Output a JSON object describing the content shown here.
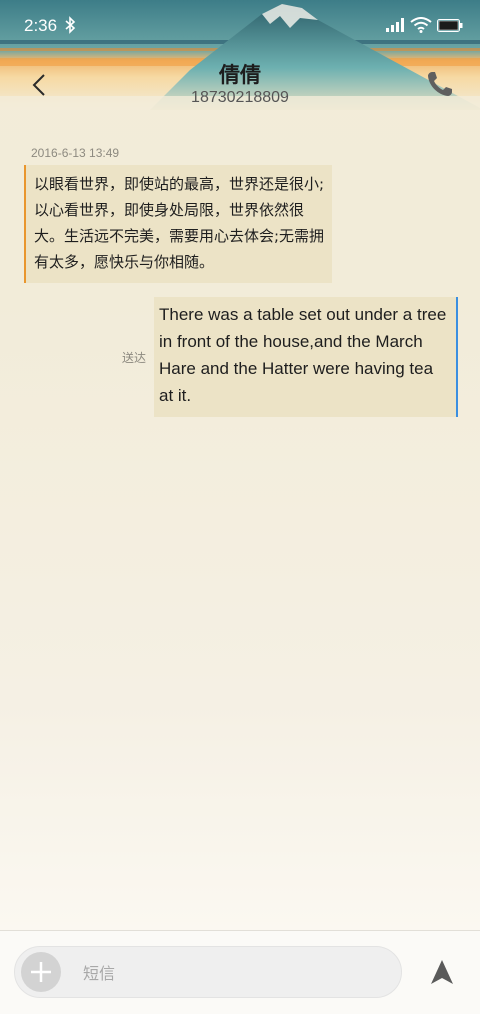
{
  "status_bar": {
    "time": "2:36"
  },
  "header": {
    "contact_name": "倩倩",
    "contact_number": "18730218809"
  },
  "conversation": {
    "timestamp": "2016-6-13 13:49",
    "messages": [
      {
        "direction": "incoming",
        "text": "以眼看世界，即使站的最高，世界还是很小;以心看世界，即使身处局限，世界依然很大。生活远不完美，需要用心去体会;无需拥有太多，愿快乐与你相随。"
      },
      {
        "direction": "outgoing",
        "text": "There was a table set out under a tree in front of the house,and the March Hare and the Hatter were having tea at it.",
        "status": "送达"
      }
    ]
  },
  "composer": {
    "placeholder": "短信"
  },
  "icons": {
    "back": "chevron-left-icon",
    "call": "phone-icon",
    "add": "plus-icon",
    "send": "send-arrow-icon",
    "bluetooth": "bluetooth-icon",
    "signal": "signal-icon",
    "wifi": "wifi-icon",
    "battery": "battery-icon"
  },
  "colors": {
    "incoming_accent": "#e9962e",
    "outgoing_accent": "#3b8fe0",
    "bubble_bg": "#ece3c6"
  }
}
